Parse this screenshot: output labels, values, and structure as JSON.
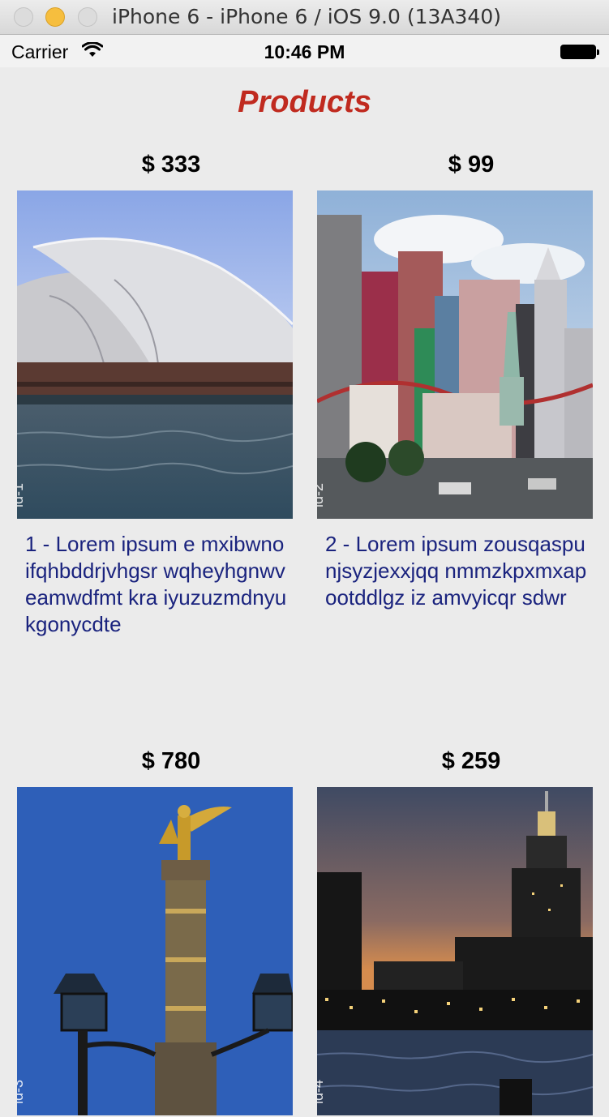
{
  "window": {
    "title": "iPhone 6 - iPhone 6 / iOS 9.0 (13A340)"
  },
  "status": {
    "carrier": "Carrier",
    "time": "10:46 PM"
  },
  "page": {
    "title": "Products"
  },
  "products": [
    {
      "price": "$ 333",
      "label": "id-1",
      "description": "1 - Lorem ipsum e mxibwnoifqhbddrjvhgsr wqheyhgnwveamwdfmt kra iyuzuzmdnyukgonycdte",
      "image_icon": "opera-house-photo"
    },
    {
      "price": "$ 99",
      "label": "id-2",
      "description": "2 - Lorem ipsum zousqaspunjsyzjexxjqq nmmzkpxmxapootddlgz iz amvyicqr sdwr",
      "image_icon": "city-skyline-photo"
    },
    {
      "price": "$ 780",
      "label": "id-3",
      "description": "",
      "image_icon": "victory-column-photo"
    },
    {
      "price": "$ 259",
      "label": "id-4",
      "description": "",
      "image_icon": "night-skyline-photo"
    }
  ],
  "colors": {
    "title": "#c02a1f",
    "description": "#1a237e",
    "background": "#ebebeb"
  }
}
